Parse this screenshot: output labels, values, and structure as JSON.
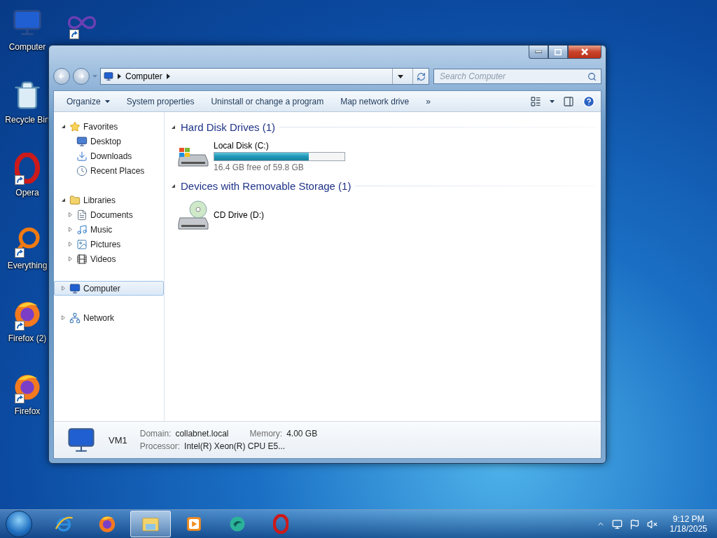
{
  "desktop_icons": [
    {
      "kind": "computer",
      "label": "Computer",
      "shortcut": false
    },
    {
      "kind": "recycle",
      "label": "Recycle Bin",
      "shortcut": false
    },
    {
      "kind": "opera",
      "label": "Opera",
      "shortcut": true
    },
    {
      "kind": "everything",
      "label": "Everything",
      "shortcut": true
    },
    {
      "kind": "firefox",
      "label": "Firefox (2)",
      "shortcut": true
    },
    {
      "kind": "firefox",
      "label": "Firefox",
      "shortcut": true
    },
    {
      "kind": "infinity",
      "shortcut": true
    }
  ],
  "window": {
    "address": {
      "crumbs": [
        "Computer"
      ]
    },
    "search": {
      "placeholder": "Search Computer"
    },
    "toolbar": {
      "buttons": [
        {
          "label": "Organize",
          "dropdown": true
        },
        {
          "label": "System properties",
          "dropdown": false
        },
        {
          "label": "Uninstall or change a program",
          "dropdown": false
        },
        {
          "label": "Map network drive",
          "dropdown": false
        }
      ],
      "overflow": "»"
    },
    "nav_pane": [
      {
        "label": "Favorites",
        "kind": "favorites",
        "expanded": true,
        "selected": false,
        "children": [
          {
            "label": "Desktop",
            "kind": "desktop",
            "selected": false
          },
          {
            "label": "Downloads",
            "kind": "downloads",
            "selected": false
          },
          {
            "label": "Recent Places",
            "kind": "recent",
            "selected": false
          }
        ]
      },
      {
        "label": "Libraries",
        "kind": "libraries",
        "expanded": true,
        "selected": false,
        "children": [
          {
            "label": "Documents",
            "kind": "documents",
            "expanded": false,
            "selected": false
          },
          {
            "label": "Music",
            "kind": "music",
            "expanded": false,
            "selected": false
          },
          {
            "label": "Pictures",
            "kind": "pictures",
            "expanded": false,
            "selected": false
          },
          {
            "label": "Videos",
            "kind": "videos",
            "expanded": false,
            "selected": false
          }
        ]
      },
      {
        "label": "Computer",
        "kind": "computer",
        "expanded": false,
        "selected": true
      },
      {
        "label": "Network",
        "kind": "network",
        "expanded": false,
        "selected": false
      }
    ],
    "sections": [
      {
        "title": "Hard Disk Drives (1)",
        "expanded": true,
        "items": [
          {
            "name": "Local Disk (C:)",
            "kind": "hdd",
            "level": 0.726,
            "reading": "16.4 GB free of 59.8 GB"
          }
        ]
      },
      {
        "title": "Devices with Removable Storage (1)",
        "expanded": true,
        "items": [
          {
            "name": "CD Drive (D:)",
            "kind": "cd"
          }
        ]
      }
    ],
    "details": {
      "name": "VM1",
      "rows": [
        [
          {
            "label": "Domain:",
            "value": "collabnet.local"
          },
          {
            "label": "Memory:",
            "value": "4.00 GB"
          }
        ],
        [
          {
            "label": "Processor:",
            "value": "Intel(R) Xeon(R) CPU E5..."
          }
        ]
      ]
    }
  },
  "taskbar": {
    "items": [
      {
        "kind": "ie",
        "selected": false
      },
      {
        "kind": "firefox",
        "selected": false
      },
      {
        "kind": "explorer",
        "selected": true
      },
      {
        "kind": "media",
        "selected": false
      },
      {
        "kind": "swirl",
        "selected": false
      },
      {
        "kind": "opera",
        "selected": false
      }
    ],
    "time": "9:12 PM",
    "date": "1/18/2025"
  }
}
